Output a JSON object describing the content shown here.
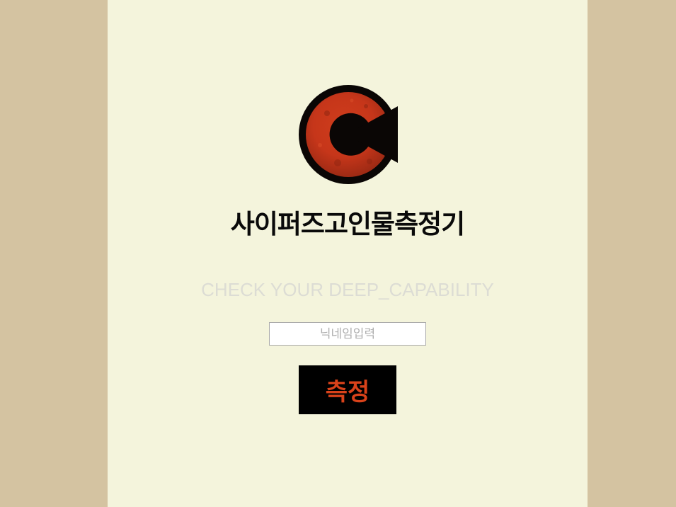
{
  "logo": {
    "icon": "c-logo-icon",
    "ring_color": "#0a0605",
    "fill_color": "#c6361a"
  },
  "title": "사이퍼즈고인물측정기",
  "subtitle": "CHECK YOUR DEEP_CAPABILITY",
  "nickname_input": {
    "value": "",
    "placeholder": "닉네임입력"
  },
  "measure_button": {
    "label": "측정",
    "text_color": "#d9421a",
    "background": "#000000"
  },
  "colors": {
    "page_background": "#d4c3a1",
    "panel_background": "#f4f4dc",
    "subtitle": "#dcdcd4"
  }
}
